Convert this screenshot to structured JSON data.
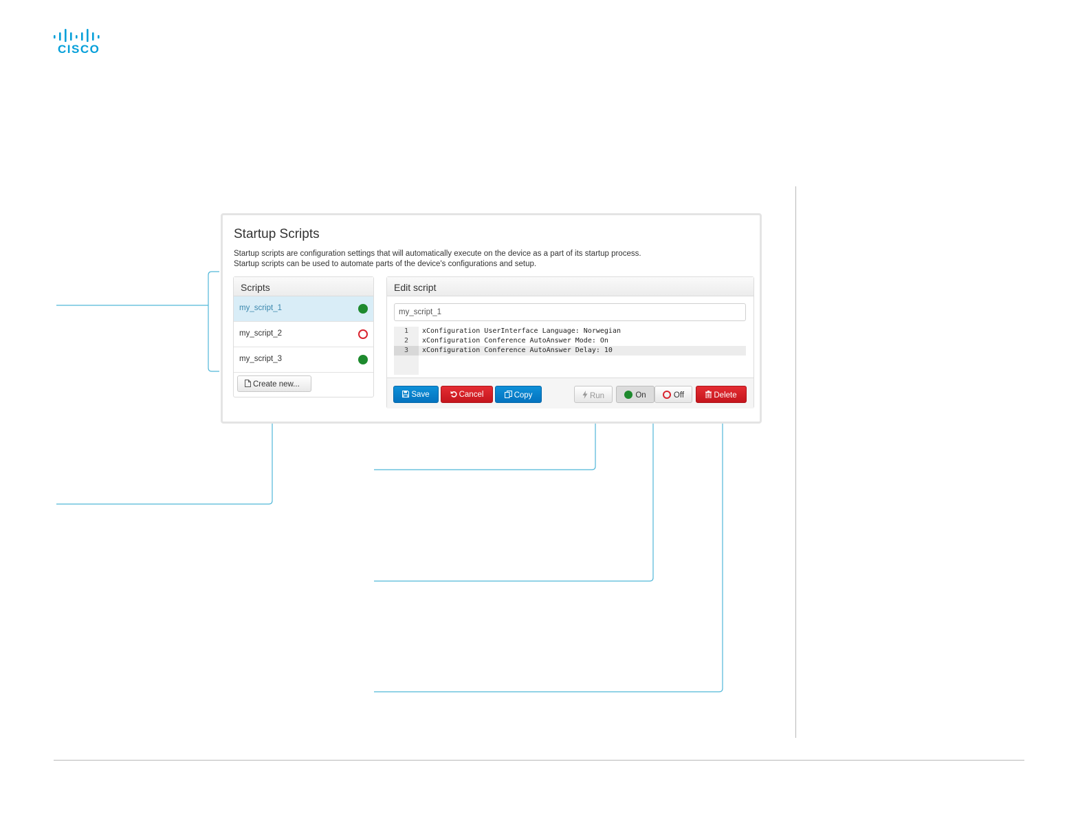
{
  "logo": {
    "brand": "CISCO"
  },
  "panel": {
    "title": "Startup Scripts",
    "description_line1": "Startup scripts are configuration settings that will automatically execute on the device as a part of its startup process.",
    "description_line2": "Startup scripts can be used to automate parts of the device's configurations and setup."
  },
  "scripts": {
    "header": "Scripts",
    "items": [
      {
        "name": "my_script_1",
        "status": "on",
        "selected": true
      },
      {
        "name": "my_script_2",
        "status": "off",
        "selected": false
      },
      {
        "name": "my_script_3",
        "status": "on",
        "selected": false
      }
    ],
    "create_label": "Create new..."
  },
  "editor": {
    "header": "Edit script",
    "script_name": "my_script_1",
    "lines": [
      {
        "num": "1",
        "text": "xConfiguration UserInterface Language: Norwegian"
      },
      {
        "num": "2",
        "text": "xConfiguration Conference AutoAnswer Mode: On"
      },
      {
        "num": "3",
        "text": "xConfiguration Conference AutoAnswer Delay: 10"
      }
    ],
    "buttons": {
      "save": "Save",
      "cancel": "Cancel",
      "copy": "Copy",
      "run": "Run",
      "on": "On",
      "off": "Off",
      "delete": "Delete"
    }
  },
  "icons": {
    "logo": "cisco-logo",
    "create": "file-icon",
    "save": "floppy-disk-icon",
    "cancel": "undo-icon",
    "copy": "copy-icon",
    "run": "lightning-bolt-icon",
    "delete": "trash-icon"
  },
  "colors": {
    "cisco_blue": "#049fd9",
    "selected_bg": "#d9edf7",
    "status_on": "#1e8a2e",
    "status_off": "#d9232e",
    "primary_button": "#0473bf",
    "danger_button": "#c5161d",
    "callout_line": "#4fb6d8"
  }
}
